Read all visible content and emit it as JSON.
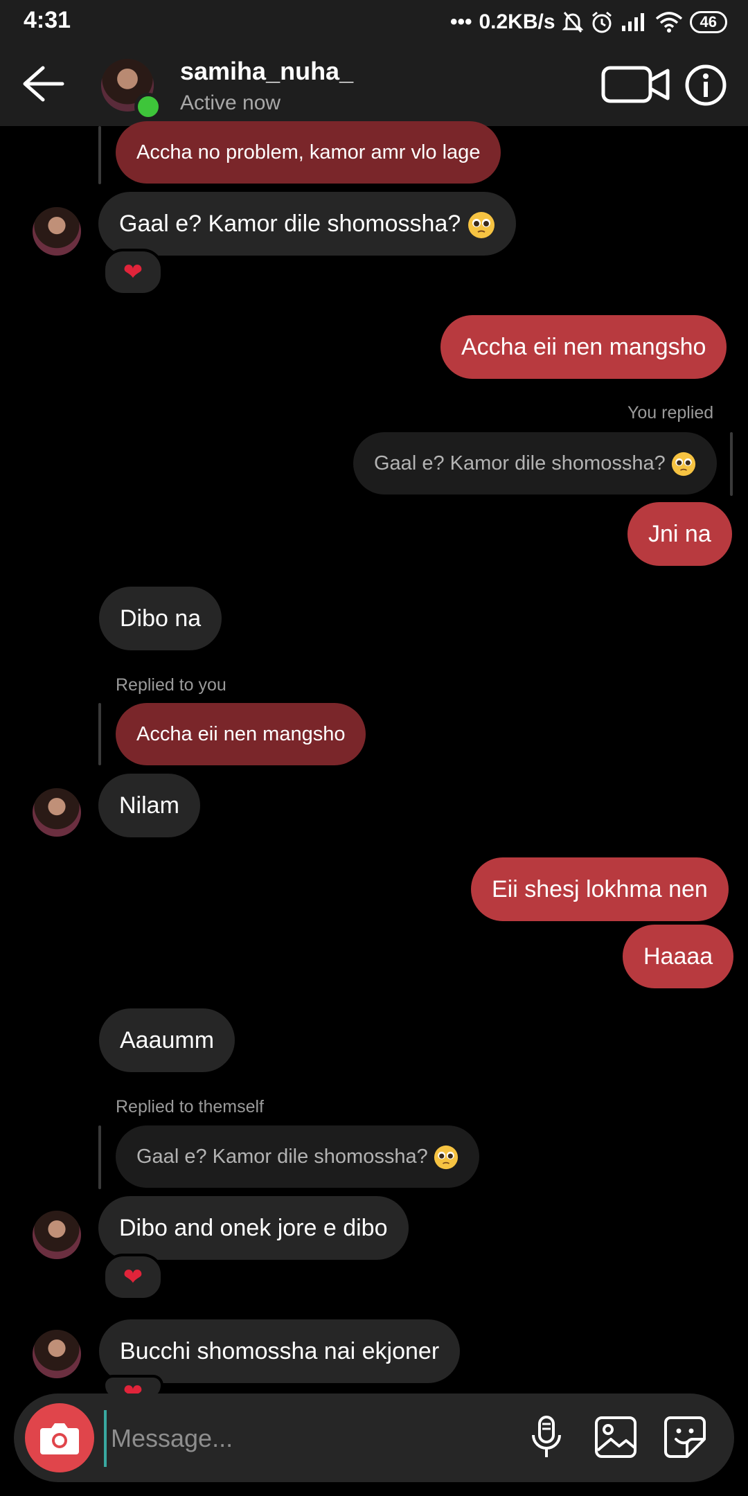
{
  "status_bar": {
    "time": "4:31",
    "network_speed": "0.2KB/s",
    "battery": "46"
  },
  "header": {
    "username": "samiha_nuha_",
    "status": "Active now"
  },
  "messages": {
    "m1_quoted": "Accha no problem, kamor amr vlo lage",
    "m2": "Gaal e? Kamor dile shomossha?",
    "m3": "Accha eii nen mangsho",
    "m4_label": "You replied",
    "m4_quoted": "Gaal e? Kamor dile shomossha?",
    "m4": "Jni na",
    "m5": "Dibo na",
    "m6_label": "Replied to you",
    "m6_quoted": "Accha eii nen mangsho",
    "m6": "Nilam",
    "m7": "Eii shesj lokhma nen",
    "m8": "Haaaa",
    "m9": "Aaaumm",
    "m10_label": "Replied to themself",
    "m10_quoted": "Gaal e? Kamor dile shomossha?",
    "m10": "Dibo and onek jore e dibo",
    "m11": "Bucchi shomossha nai ekjoner"
  },
  "composer": {
    "placeholder": "Message..."
  },
  "icons": {
    "reaction": "heart-icon",
    "emoji": "pleading-face-icon"
  },
  "colors": {
    "outgoing_bubble": "#b83a3f",
    "incoming_bubble": "#262626",
    "online": "#3ec53a",
    "camera_button": "#e0454b"
  }
}
